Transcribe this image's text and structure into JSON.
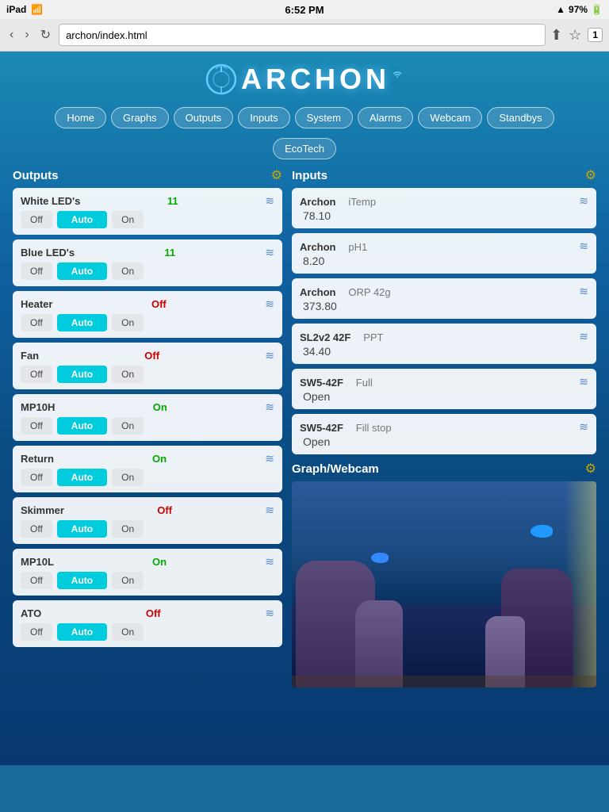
{
  "status_bar": {
    "left": "iPad",
    "wifi": "WiFi",
    "time": "6:52 PM",
    "signal": "▲",
    "battery": "97%",
    "tab_count": "1"
  },
  "browser": {
    "url": "archon/index.html",
    "back": "‹",
    "forward": "›",
    "reload": "↻",
    "share": "↑",
    "bookmark": "☆"
  },
  "app_title": "ARCHON",
  "nav": {
    "items": [
      {
        "label": "Home",
        "id": "home"
      },
      {
        "label": "Graphs",
        "id": "graphs"
      },
      {
        "label": "Outputs",
        "id": "outputs"
      },
      {
        "label": "Inputs",
        "id": "inputs"
      },
      {
        "label": "System",
        "id": "system"
      },
      {
        "label": "Alarms",
        "id": "alarms"
      },
      {
        "label": "Webcam",
        "id": "webcam"
      },
      {
        "label": "Standbys",
        "id": "standbys"
      }
    ],
    "row2": [
      {
        "label": "EcoTech",
        "id": "ecotech"
      }
    ]
  },
  "outputs": {
    "title": "Outputs",
    "gear": "⚙",
    "items": [
      {
        "name": "White LED's",
        "status": "11",
        "status_type": "green",
        "btn_off": "Off",
        "btn_auto": "Auto",
        "btn_on": "On"
      },
      {
        "name": "Blue LED's",
        "status": "11",
        "status_type": "green",
        "btn_off": "Off",
        "btn_auto": "Auto",
        "btn_on": "On"
      },
      {
        "name": "Heater",
        "status": "Off",
        "status_type": "red",
        "btn_off": "Off",
        "btn_auto": "Auto",
        "btn_on": "On"
      },
      {
        "name": "Fan",
        "status": "Off",
        "status_type": "red",
        "btn_off": "Off",
        "btn_auto": "Auto",
        "btn_on": "On"
      },
      {
        "name": "MP10H",
        "status": "On",
        "status_type": "green",
        "btn_off": "Off",
        "btn_auto": "Auto",
        "btn_on": "On"
      },
      {
        "name": "Return",
        "status": "On",
        "status_type": "green",
        "btn_off": "Off",
        "btn_auto": "Auto",
        "btn_on": "On"
      },
      {
        "name": "Skimmer",
        "status": "Off",
        "status_type": "red",
        "btn_off": "Off",
        "btn_auto": "Auto",
        "btn_on": "On"
      },
      {
        "name": "MP10L",
        "status": "On",
        "status_type": "green",
        "btn_off": "Off",
        "btn_auto": "Auto",
        "btn_on": "On"
      },
      {
        "name": "ATO",
        "status": "Off",
        "status_type": "red",
        "btn_off": "Off",
        "btn_auto": "Auto",
        "btn_on": "On"
      }
    ]
  },
  "inputs": {
    "title": "Inputs",
    "gear": "⚙",
    "items": [
      {
        "source": "Archon",
        "label": "iTemp",
        "value": "78.10"
      },
      {
        "source": "Archon",
        "label": "pH1",
        "value": "8.20"
      },
      {
        "source": "Archon",
        "label": "ORP 42g",
        "value": "373.80"
      },
      {
        "source": "SL2v2 42F",
        "label": "PPT",
        "value": "34.40"
      },
      {
        "source": "SW5-42F",
        "label": "Full",
        "value": "Open"
      },
      {
        "source": "SW5-42F",
        "label": "Fill stop",
        "value": "Open"
      }
    ]
  },
  "graph_webcam": {
    "title": "Graph/Webcam",
    "gear": "⚙"
  },
  "wave_icon": "≋"
}
